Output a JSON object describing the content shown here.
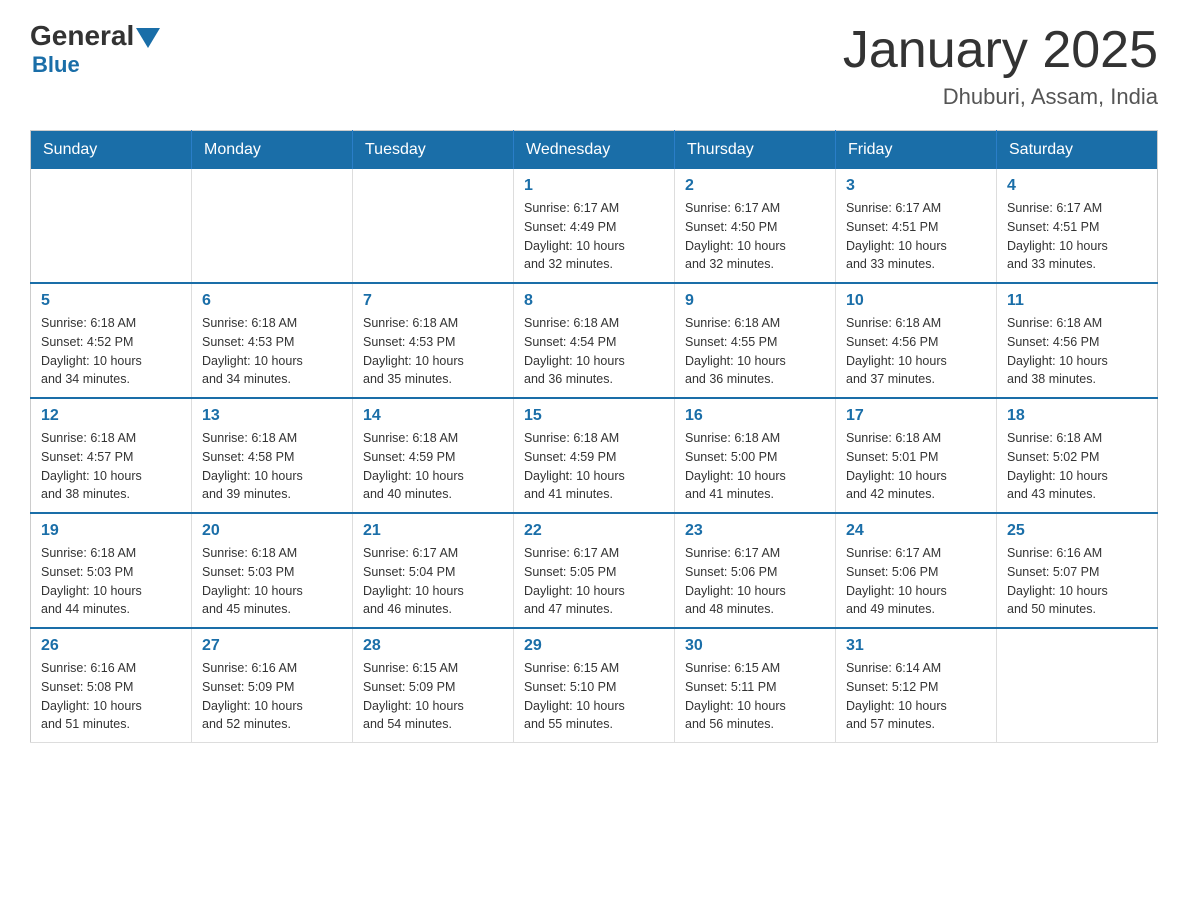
{
  "header": {
    "logo": {
      "general": "General",
      "arrow_color": "#1a6ea8",
      "blue": "Blue"
    },
    "title": "January 2025",
    "subtitle": "Dhuburi, Assam, India"
  },
  "calendar": {
    "days_of_week": [
      "Sunday",
      "Monday",
      "Tuesday",
      "Wednesday",
      "Thursday",
      "Friday",
      "Saturday"
    ],
    "weeks": [
      {
        "days": [
          {
            "number": "",
            "info": ""
          },
          {
            "number": "",
            "info": ""
          },
          {
            "number": "",
            "info": ""
          },
          {
            "number": "1",
            "info": "Sunrise: 6:17 AM\nSunset: 4:49 PM\nDaylight: 10 hours\nand 32 minutes."
          },
          {
            "number": "2",
            "info": "Sunrise: 6:17 AM\nSunset: 4:50 PM\nDaylight: 10 hours\nand 32 minutes."
          },
          {
            "number": "3",
            "info": "Sunrise: 6:17 AM\nSunset: 4:51 PM\nDaylight: 10 hours\nand 33 minutes."
          },
          {
            "number": "4",
            "info": "Sunrise: 6:17 AM\nSunset: 4:51 PM\nDaylight: 10 hours\nand 33 minutes."
          }
        ]
      },
      {
        "days": [
          {
            "number": "5",
            "info": "Sunrise: 6:18 AM\nSunset: 4:52 PM\nDaylight: 10 hours\nand 34 minutes."
          },
          {
            "number": "6",
            "info": "Sunrise: 6:18 AM\nSunset: 4:53 PM\nDaylight: 10 hours\nand 34 minutes."
          },
          {
            "number": "7",
            "info": "Sunrise: 6:18 AM\nSunset: 4:53 PM\nDaylight: 10 hours\nand 35 minutes."
          },
          {
            "number": "8",
            "info": "Sunrise: 6:18 AM\nSunset: 4:54 PM\nDaylight: 10 hours\nand 36 minutes."
          },
          {
            "number": "9",
            "info": "Sunrise: 6:18 AM\nSunset: 4:55 PM\nDaylight: 10 hours\nand 36 minutes."
          },
          {
            "number": "10",
            "info": "Sunrise: 6:18 AM\nSunset: 4:56 PM\nDaylight: 10 hours\nand 37 minutes."
          },
          {
            "number": "11",
            "info": "Sunrise: 6:18 AM\nSunset: 4:56 PM\nDaylight: 10 hours\nand 38 minutes."
          }
        ]
      },
      {
        "days": [
          {
            "number": "12",
            "info": "Sunrise: 6:18 AM\nSunset: 4:57 PM\nDaylight: 10 hours\nand 38 minutes."
          },
          {
            "number": "13",
            "info": "Sunrise: 6:18 AM\nSunset: 4:58 PM\nDaylight: 10 hours\nand 39 minutes."
          },
          {
            "number": "14",
            "info": "Sunrise: 6:18 AM\nSunset: 4:59 PM\nDaylight: 10 hours\nand 40 minutes."
          },
          {
            "number": "15",
            "info": "Sunrise: 6:18 AM\nSunset: 4:59 PM\nDaylight: 10 hours\nand 41 minutes."
          },
          {
            "number": "16",
            "info": "Sunrise: 6:18 AM\nSunset: 5:00 PM\nDaylight: 10 hours\nand 41 minutes."
          },
          {
            "number": "17",
            "info": "Sunrise: 6:18 AM\nSunset: 5:01 PM\nDaylight: 10 hours\nand 42 minutes."
          },
          {
            "number": "18",
            "info": "Sunrise: 6:18 AM\nSunset: 5:02 PM\nDaylight: 10 hours\nand 43 minutes."
          }
        ]
      },
      {
        "days": [
          {
            "number": "19",
            "info": "Sunrise: 6:18 AM\nSunset: 5:03 PM\nDaylight: 10 hours\nand 44 minutes."
          },
          {
            "number": "20",
            "info": "Sunrise: 6:18 AM\nSunset: 5:03 PM\nDaylight: 10 hours\nand 45 minutes."
          },
          {
            "number": "21",
            "info": "Sunrise: 6:17 AM\nSunset: 5:04 PM\nDaylight: 10 hours\nand 46 minutes."
          },
          {
            "number": "22",
            "info": "Sunrise: 6:17 AM\nSunset: 5:05 PM\nDaylight: 10 hours\nand 47 minutes."
          },
          {
            "number": "23",
            "info": "Sunrise: 6:17 AM\nSunset: 5:06 PM\nDaylight: 10 hours\nand 48 minutes."
          },
          {
            "number": "24",
            "info": "Sunrise: 6:17 AM\nSunset: 5:06 PM\nDaylight: 10 hours\nand 49 minutes."
          },
          {
            "number": "25",
            "info": "Sunrise: 6:16 AM\nSunset: 5:07 PM\nDaylight: 10 hours\nand 50 minutes."
          }
        ]
      },
      {
        "days": [
          {
            "number": "26",
            "info": "Sunrise: 6:16 AM\nSunset: 5:08 PM\nDaylight: 10 hours\nand 51 minutes."
          },
          {
            "number": "27",
            "info": "Sunrise: 6:16 AM\nSunset: 5:09 PM\nDaylight: 10 hours\nand 52 minutes."
          },
          {
            "number": "28",
            "info": "Sunrise: 6:15 AM\nSunset: 5:09 PM\nDaylight: 10 hours\nand 54 minutes."
          },
          {
            "number": "29",
            "info": "Sunrise: 6:15 AM\nSunset: 5:10 PM\nDaylight: 10 hours\nand 55 minutes."
          },
          {
            "number": "30",
            "info": "Sunrise: 6:15 AM\nSunset: 5:11 PM\nDaylight: 10 hours\nand 56 minutes."
          },
          {
            "number": "31",
            "info": "Sunrise: 6:14 AM\nSunset: 5:12 PM\nDaylight: 10 hours\nand 57 minutes."
          },
          {
            "number": "",
            "info": ""
          }
        ]
      }
    ]
  }
}
